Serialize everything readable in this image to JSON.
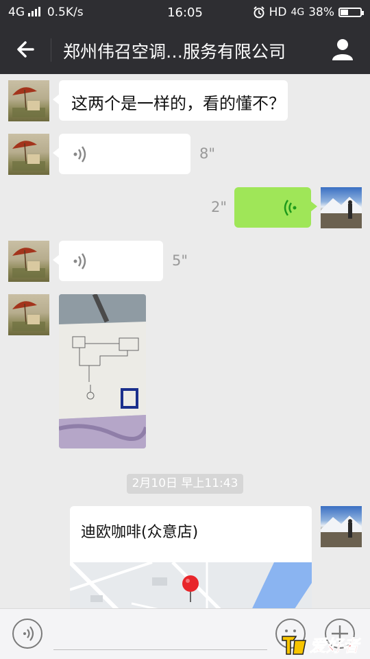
{
  "status_bar": {
    "network": "4G",
    "speed": "0.5K/s",
    "time": "16:05",
    "hd_label": "HD",
    "network2": "4G",
    "battery": "38%",
    "battery_level": 0.38
  },
  "header": {
    "title": "郑州伟召空调…服务有限公司"
  },
  "messages": [
    {
      "side": "left",
      "type": "text",
      "text": "这两个是一样的，看的懂不？"
    },
    {
      "side": "left",
      "type": "voice",
      "duration": "8\""
    },
    {
      "side": "right",
      "type": "voice",
      "duration": "2\""
    },
    {
      "side": "left",
      "type": "voice",
      "duration": "5\""
    },
    {
      "side": "left",
      "type": "image"
    },
    {
      "type": "timestamp",
      "text": "2月10日 早上11:43"
    },
    {
      "side": "right",
      "type": "location",
      "name": "迪欧咖啡(众意店)"
    }
  ],
  "watermark": {
    "text": "爱好者"
  },
  "colors": {
    "titlebar_bg": "#2e2e32",
    "sent_bubble": "#9fe658",
    "chat_bg": "#ebebeb",
    "map_pin": "#e8262b",
    "voice_icon_green": "#1e9a1b"
  }
}
